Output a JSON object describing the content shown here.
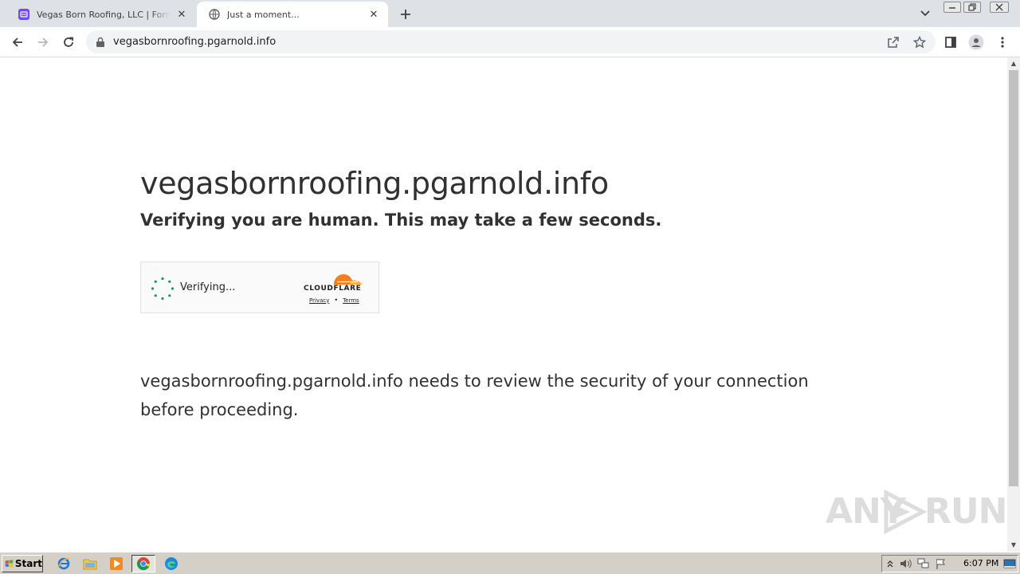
{
  "browser": {
    "tabs": [
      {
        "title": "Vegas Born Roofing, LLC | Formester",
        "favicon": "proton-icon",
        "active": false
      },
      {
        "title": "Just a moment...",
        "favicon": "globe-icon",
        "active": true
      }
    ],
    "address_bar": {
      "url": "vegasbornroofing.pgarnold.info"
    }
  },
  "page": {
    "host_title": "vegasbornroofing.pgarnold.info",
    "subtitle": "Verifying you are human. This may take a few seconds.",
    "challenge": {
      "status": "Verifying...",
      "brand": "CLOUDFLARE",
      "privacy_link": "Privacy",
      "separator": "•",
      "terms_link": "Terms"
    },
    "explanation": "vegasbornroofing.pgarnold.info needs to review the security of your connection before proceeding."
  },
  "watermark": {
    "left": "ANY",
    "right": "RUN"
  },
  "taskbar": {
    "start_label": "Start",
    "clock": "6:07 PM"
  },
  "colors": {
    "cloudflare_orange": "#f38020",
    "spinner_green": "#159a5e",
    "text": "#313131"
  }
}
